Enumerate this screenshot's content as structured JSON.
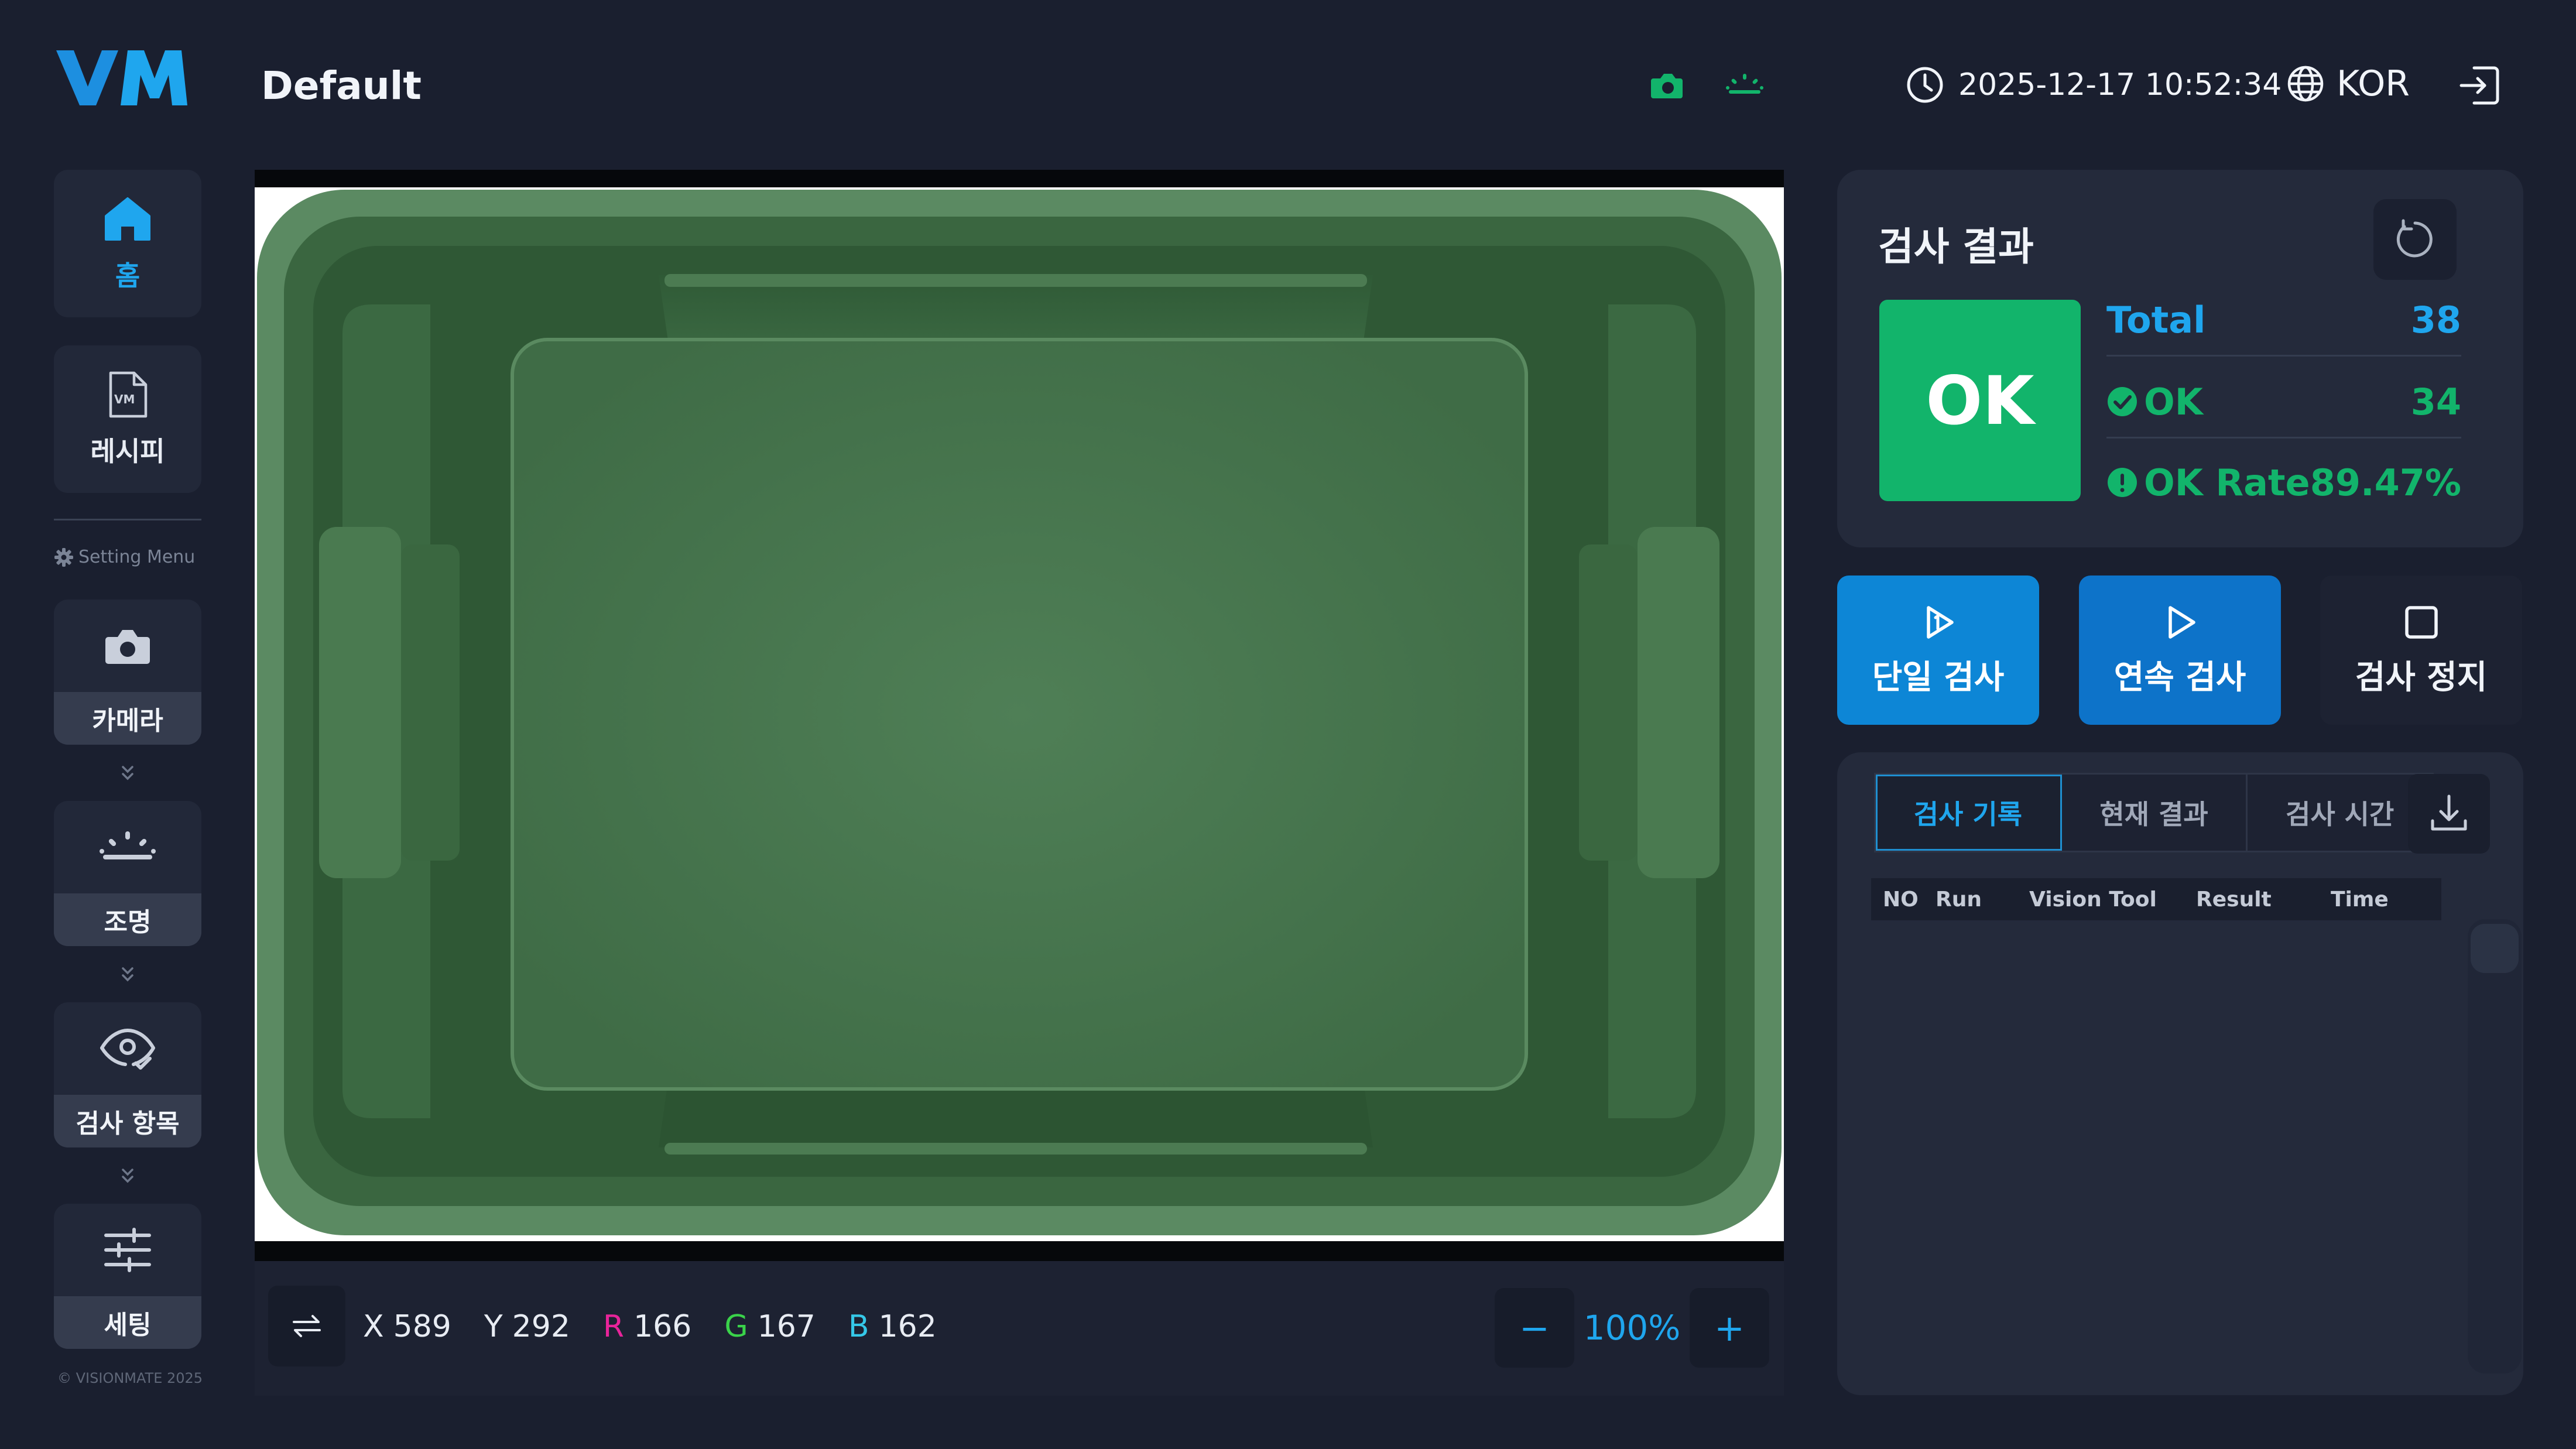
{
  "header": {
    "logo_text": "VM",
    "recipe_name": "Default",
    "datetime": "2025-12-17 10:52:34",
    "language": "KOR"
  },
  "sidebar": {
    "home_label": "홈",
    "recipe_label": "레시피",
    "setting_menu_label": "Setting Menu",
    "camera_label": "카메라",
    "lighting_label": "조명",
    "inspection_items_label": "검사 항목",
    "settings_label": "세팅",
    "copyright": "© VISIONMATE 2025"
  },
  "viewer": {
    "coords": {
      "x_label": "X",
      "x": "589",
      "y_label": "Y",
      "y": "292",
      "r_label": "R",
      "r": "166",
      "g_label": "G",
      "g": "167",
      "b_label": "B",
      "b": "162"
    },
    "zoom": "100%",
    "zoom_minus": "−",
    "zoom_plus": "+"
  },
  "result": {
    "title": "검사 결과",
    "status": "OK",
    "total_label": "Total",
    "total": "38",
    "ok_label": "OK",
    "ok": "34",
    "rate_label": "OK Rate",
    "rate": "89.47%"
  },
  "actions": {
    "single_label": "단일 검사",
    "continuous_label": "연속 검사",
    "stop_label": "검사 정지"
  },
  "history": {
    "tabs": [
      "검사 기록",
      "현재 결과",
      "검사 시간"
    ],
    "columns": [
      "NO",
      "Run",
      "Vision Tool",
      "Result",
      "Time"
    ]
  },
  "colors": {
    "accent_blue": "#1fa6ee",
    "ok_green": "#12b46b",
    "background": "#1a1f2f",
    "panel": "#242a3b"
  }
}
